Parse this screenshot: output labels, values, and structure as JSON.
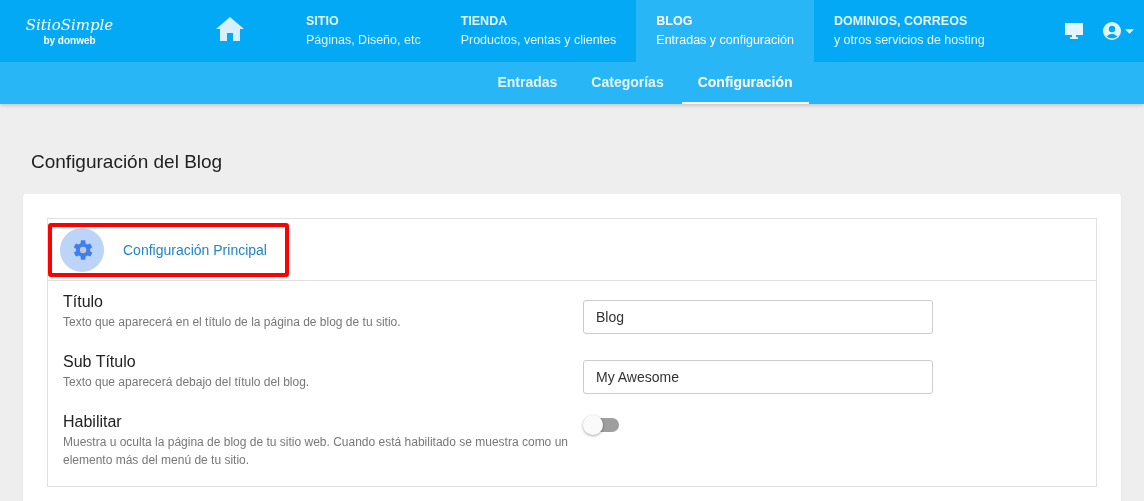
{
  "logo": {
    "name": "SitioSimple",
    "byline": "by donweb"
  },
  "nav": [
    {
      "title": "SITIO",
      "subtitle": "Páginas, Diseño, etc",
      "selected": false
    },
    {
      "title": "TIENDA",
      "subtitle": "Productos, ventas y clientes",
      "selected": false
    },
    {
      "title": "BLOG",
      "subtitle": "Entradas y configuración",
      "selected": true
    },
    {
      "title": "DOMINIOS, CORREOS",
      "subtitle": "y otros servicios de hosting",
      "selected": false
    }
  ],
  "subnav": [
    {
      "label": "Entradas",
      "selected": false
    },
    {
      "label": "Categorías",
      "selected": false
    },
    {
      "label": "Configuración",
      "selected": true
    }
  ],
  "page_title": "Configuración del Blog",
  "section": {
    "title": "Configuración Principal",
    "highlighted": true
  },
  "fields": [
    {
      "kind": "text",
      "label": "Título",
      "help": "Texto que aparecerá en el título de la página de blog de tu sitio.",
      "value": "Blog"
    },
    {
      "kind": "text",
      "label": "Sub Título",
      "help": "Texto que aparecerá debajo del título del blog.",
      "value": "My Awesome"
    },
    {
      "kind": "toggle",
      "label": "Habilitar",
      "help": "Muestra u oculta la página de blog de tu sitio web. Cuando está habilitado se muestra como un elemento más del menú de tu sitio.",
      "on": false
    }
  ]
}
